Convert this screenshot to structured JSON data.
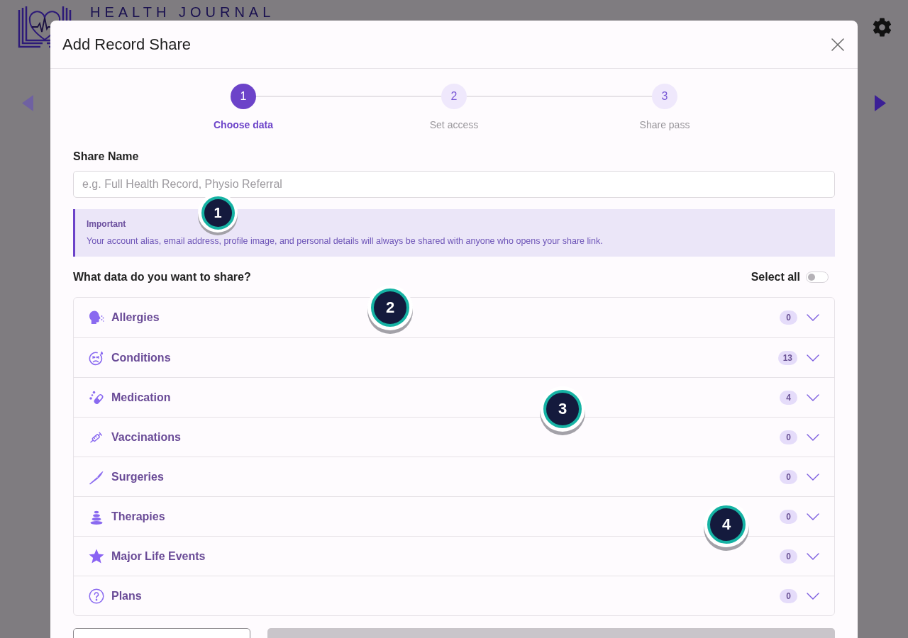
{
  "background_page": {
    "brand": "HEALTH JOURNAL"
  },
  "dialog": {
    "title": "Add Record Share",
    "steps": [
      {
        "number": "1",
        "label": "Choose data",
        "selected": true
      },
      {
        "number": "2",
        "label": "Set access",
        "selected": false
      },
      {
        "number": "3",
        "label": "Share pass",
        "selected": false
      }
    ],
    "share_name": {
      "label": "Share Name",
      "placeholder": "e.g. Full Health Record, Physio Referral"
    },
    "notice": {
      "title": "Important",
      "text": "Your account alias, email address, profile image, and personal details will always be shared with anyone who opens your share link."
    },
    "data_section": {
      "heading": "What data do you want to share?",
      "select_all": {
        "label": "Select all",
        "on": false
      },
      "categories": [
        {
          "kind": "allergies",
          "name": "Allergies",
          "count": "0",
          "expanded": false
        },
        {
          "kind": "conditions",
          "name": "Conditions",
          "count": "13",
          "expanded": false
        },
        {
          "kind": "medication",
          "name": "Medication",
          "count": "4",
          "expanded": false
        },
        {
          "kind": "vaccinations",
          "name": "Vaccinations",
          "count": "0",
          "expanded": false
        },
        {
          "kind": "surgeries",
          "name": "Surgeries",
          "count": "0",
          "expanded": false
        },
        {
          "kind": "therapies",
          "name": "Therapies",
          "count": "0",
          "expanded": false
        },
        {
          "kind": "life_events",
          "name": "Major Life Events",
          "count": "0",
          "expanded": false
        },
        {
          "kind": "plans",
          "name": "Plans",
          "count": "0",
          "expanded": false
        }
      ]
    },
    "footer_buttons": [
      {
        "kind": "secondary",
        "disabled": false
      },
      {
        "kind": "primary",
        "disabled": true
      }
    ]
  },
  "callouts": [
    {
      "label": "1"
    },
    {
      "label": "2"
    },
    {
      "label": "3"
    },
    {
      "label": "4"
    }
  ]
}
